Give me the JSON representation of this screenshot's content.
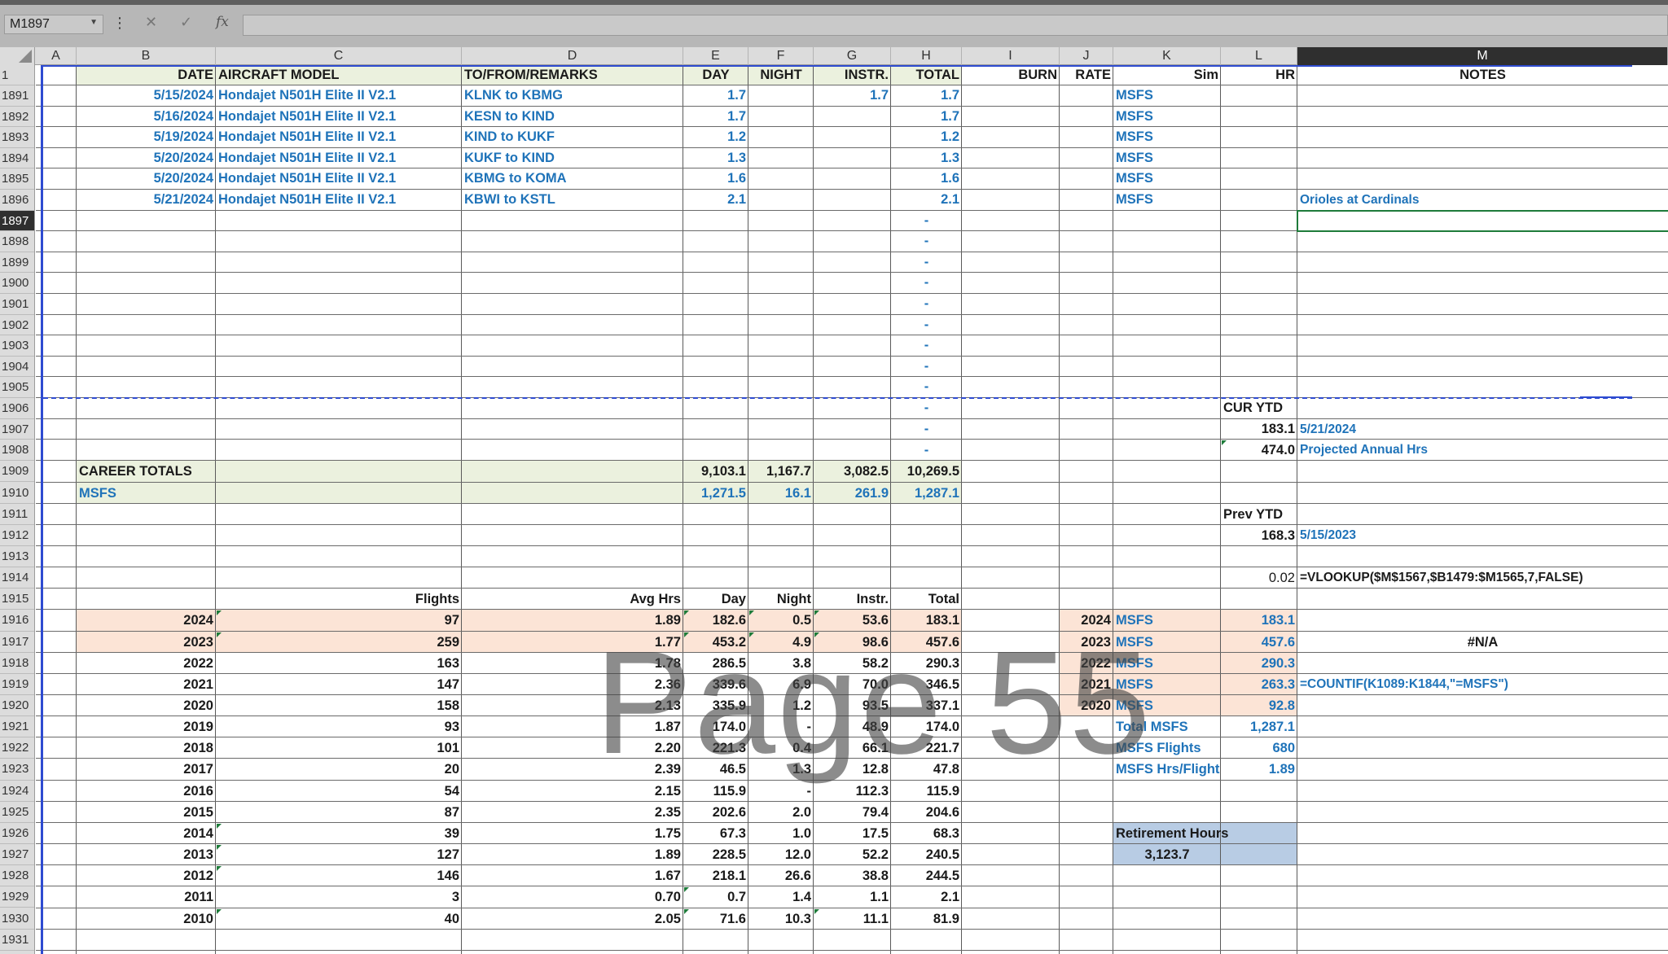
{
  "formula_bar": {
    "name_box": "M1897",
    "value": ""
  },
  "columns": [
    "A",
    "B",
    "C",
    "D",
    "E",
    "F",
    "G",
    "H",
    "I",
    "J",
    "K",
    "L",
    "M"
  ],
  "selected_column": "M",
  "selected_row": "1897",
  "rows": [
    "1",
    "1891",
    "1892",
    "1893",
    "1894",
    "1895",
    "1896",
    "1897",
    "1898",
    "1899",
    "1900",
    "1901",
    "1902",
    "1903",
    "1904",
    "1905",
    "1906",
    "1907",
    "1908",
    "1909",
    "1910",
    "1911",
    "1912",
    "1913",
    "1914",
    "1915",
    "1916",
    "1917",
    "1918",
    "1919",
    "1920",
    "1921",
    "1922",
    "1923",
    "1924",
    "1925",
    "1926",
    "1927",
    "1928",
    "1929",
    "1930",
    "1931",
    "1932"
  ],
  "header": {
    "date": "DATE",
    "aircraft": "AIRCRAFT MODEL",
    "remarks": "TO/FROM/REMARKS",
    "day": "DAY",
    "night": "NIGHT",
    "instr": "INSTR.",
    "total": "TOTAL",
    "burn": "BURN",
    "rate": "RATE",
    "sim": "Sim",
    "hr": "HR",
    "notes": "NOTES"
  },
  "flights": [
    {
      "date": "5/15/2024",
      "aircraft": "Hondajet N501H  Elite II V2.1",
      "route": "KLNK to KBMG",
      "day": "1.7",
      "instr": "1.7",
      "total": "1.7",
      "sim": "MSFS",
      "notes": ""
    },
    {
      "date": "5/16/2024",
      "aircraft": "Hondajet N501H  Elite II V2.1",
      "route": "KESN to KIND",
      "day": "1.7",
      "instr": "",
      "total": "1.7",
      "sim": "MSFS",
      "notes": ""
    },
    {
      "date": "5/19/2024",
      "aircraft": "Hondajet N501H  Elite II V2.1",
      "route": "KIND to KUKF",
      "day": "1.2",
      "instr": "",
      "total": "1.2",
      "sim": "MSFS",
      "notes": ""
    },
    {
      "date": "5/20/2024",
      "aircraft": "Hondajet N501H  Elite II V2.1",
      "route": "KUKF to KIND",
      "day": "1.3",
      "instr": "",
      "total": "1.3",
      "sim": "MSFS",
      "notes": ""
    },
    {
      "date": "5/20/2024",
      "aircraft": "Hondajet N501H  Elite II V2.1",
      "route": "KBMG to KOMA",
      "day": "1.6",
      "instr": "",
      "total": "1.6",
      "sim": "MSFS",
      "notes": ""
    },
    {
      "date": "5/21/2024",
      "aircraft": "Hondajet N501H  Elite II V2.1",
      "route": "KBWI to KSTL",
      "day": "2.1",
      "instr": "",
      "total": "2.1",
      "sim": "MSFS",
      "notes": "Orioles at Cardinals"
    }
  ],
  "dash": "-",
  "ytd": {
    "cur_label": "CUR YTD",
    "cur_value": "183.1",
    "cur_date": "5/21/2024",
    "proj_value": "474.0",
    "proj_label": "Projected Annual Hrs",
    "prev_label": "Prev YTD",
    "prev_value": "168.3",
    "prev_date": "5/15/2023",
    "lookup_value": "0.02",
    "lookup_formula": "=VLOOKUP($M$1567,$B1479:$M1565,7,FALSE)"
  },
  "career": {
    "label": "CAREER TOTALS",
    "day": "9,103.1",
    "night": "1,167.7",
    "instr": "3,082.5",
    "total": "10,269.5"
  },
  "msfs_totals": {
    "label": "MSFS",
    "day": "1,271.5",
    "night": "16.1",
    "instr": "261.9",
    "total": "1,287.1"
  },
  "summary_header": {
    "flights": "Flights",
    "avg": "Avg Hrs",
    "day": "Day",
    "night": "Night",
    "instr": "Instr.",
    "total": "Total"
  },
  "years": [
    {
      "year": "2024",
      "flights": "97",
      "avg": "1.89",
      "day": "182.6",
      "night": "0.5",
      "instr": "53.6",
      "total": "183.1"
    },
    {
      "year": "2023",
      "flights": "259",
      "avg": "1.77",
      "day": "453.2",
      "night": "4.9",
      "instr": "98.6",
      "total": "457.6"
    },
    {
      "year": "2022",
      "flights": "163",
      "avg": "1.78",
      "day": "286.5",
      "night": "3.8",
      "instr": "58.2",
      "total": "290.3"
    },
    {
      "year": "2021",
      "flights": "147",
      "avg": "2.36",
      "day": "339.6",
      "night": "6.9",
      "instr": "70.0",
      "total": "346.5"
    },
    {
      "year": "2020",
      "flights": "158",
      "avg": "2.13",
      "day": "335.9",
      "night": "1.2",
      "instr": "93.5",
      "total": "337.1"
    },
    {
      "year": "2019",
      "flights": "93",
      "avg": "1.87",
      "day": "174.0",
      "night": "-",
      "instr": "48.9",
      "total": "174.0"
    },
    {
      "year": "2018",
      "flights": "101",
      "avg": "2.20",
      "day": "221.3",
      "night": "0.4",
      "instr": "66.1",
      "total": "221.7"
    },
    {
      "year": "2017",
      "flights": "20",
      "avg": "2.39",
      "day": "46.5",
      "night": "1.3",
      "instr": "12.8",
      "total": "47.8"
    },
    {
      "year": "2016",
      "flights": "54",
      "avg": "2.15",
      "day": "115.9",
      "night": "-",
      "instr": "112.3",
      "total": "115.9"
    },
    {
      "year": "2015",
      "flights": "87",
      "avg": "2.35",
      "day": "202.6",
      "night": "2.0",
      "instr": "79.4",
      "total": "204.6"
    },
    {
      "year": "2014",
      "flights": "39",
      "avg": "1.75",
      "day": "67.3",
      "night": "1.0",
      "instr": "17.5",
      "total": "68.3"
    },
    {
      "year": "2013",
      "flights": "127",
      "avg": "1.89",
      "day": "228.5",
      "night": "12.0",
      "instr": "52.2",
      "total": "240.5"
    },
    {
      "year": "2012",
      "flights": "146",
      "avg": "1.67",
      "day": "218.1",
      "night": "26.6",
      "instr": "38.8",
      "total": "244.5"
    },
    {
      "year": "2011",
      "flights": "3",
      "avg": "0.70",
      "day": "0.7",
      "night": "1.4",
      "instr": "1.1",
      "total": "2.1"
    },
    {
      "year": "2010",
      "flights": "40",
      "avg": "2.05",
      "day": "71.6",
      "night": "10.3",
      "instr": "11.1",
      "total": "81.9"
    }
  ],
  "msfs_by_year": [
    {
      "year": "2024",
      "sim": "MSFS",
      "hours": "183.1"
    },
    {
      "year": "2023",
      "sim": "MSFS",
      "hours": "457.6"
    },
    {
      "year": "2022",
      "sim": "MSFS",
      "hours": "290.3"
    },
    {
      "year": "2021",
      "sim": "MSFS",
      "hours": "263.3"
    },
    {
      "year": "2020",
      "sim": "MSFS",
      "hours": "92.8"
    }
  ],
  "msfs_stats": [
    {
      "label": "Total MSFS",
      "value": "1,287.1"
    },
    {
      "label": "MSFS Flights",
      "value": "680"
    },
    {
      "label": "MSFS Hrs/Flight",
      "value": "1.89"
    }
  ],
  "na_value": "#N/A",
  "countif_formula": "=COUNTIF(K1089:K1844,\"=MSFS\")",
  "retirement": {
    "label": "Retirement Hours",
    "value": "3,123.7"
  },
  "watermark": "Page 55",
  "colors": {
    "link_blue": "#1f73b9",
    "header_green": "#ebf1de",
    "year_peach": "#fce4d6",
    "retire_blue": "#b8cce4"
  }
}
